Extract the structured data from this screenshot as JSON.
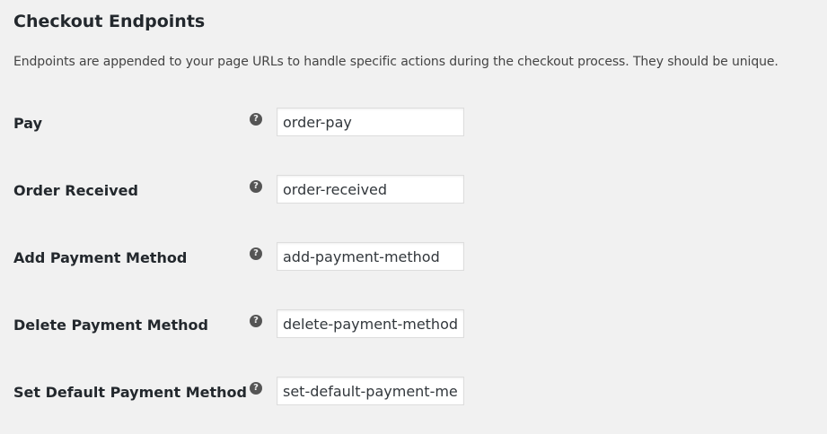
{
  "section": {
    "title": "Checkout Endpoints",
    "description": "Endpoints are appended to your page URLs to handle specific actions during the checkout process. They should be unique."
  },
  "help_icon": {
    "glyph": "?",
    "icon": "help-question-icon"
  },
  "fields": [
    {
      "label": "Pay",
      "value": "order-pay"
    },
    {
      "label": "Order Received",
      "value": "order-received"
    },
    {
      "label": "Add Payment Method",
      "value": "add-payment-method"
    },
    {
      "label": "Delete Payment Method",
      "value": "delete-payment-method"
    },
    {
      "label": "Set Default Payment Method",
      "value": "set-default-payment-method"
    }
  ]
}
